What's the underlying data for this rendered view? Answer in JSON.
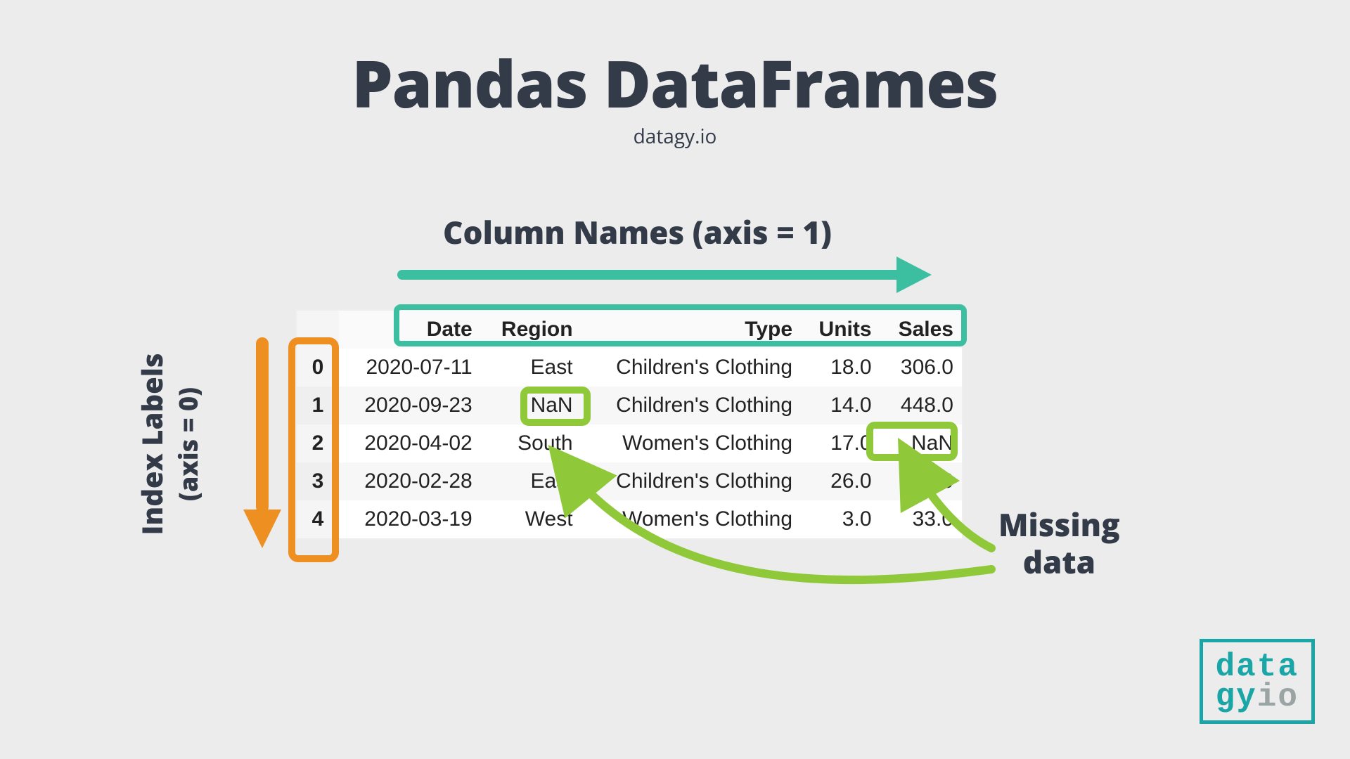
{
  "title": "Pandas DataFrames",
  "subtitle": "datagy.io",
  "labels": {
    "columns": "Column Names (axis = 1)",
    "index_line1": "Index Labels",
    "index_line2": "(axis = 0)",
    "missing_line1": "Missing",
    "missing_line2": "data"
  },
  "columns": [
    "Date",
    "Region",
    "Type",
    "Units",
    "Sales"
  ],
  "index": [
    "0",
    "1",
    "2",
    "3",
    "4"
  ],
  "rows": [
    {
      "Date": "2020-07-11",
      "Region": "East",
      "Type": "Children's Clothing",
      "Units": "18.0",
      "Sales": "306.0"
    },
    {
      "Date": "2020-09-23",
      "Region": "NaN",
      "Type": "Children's Clothing",
      "Units": "14.0",
      "Sales": "448.0"
    },
    {
      "Date": "2020-04-02",
      "Region": "South",
      "Type": "Women's Clothing",
      "Units": "17.0",
      "Sales": "NaN"
    },
    {
      "Date": "2020-02-28",
      "Region": "East",
      "Type": "Children's Clothing",
      "Units": "26.0",
      "Sales": "832.0"
    },
    {
      "Date": "2020-03-19",
      "Region": "West",
      "Type": "Women's Clothing",
      "Units": "3.0",
      "Sales": "33.0"
    }
  ],
  "logo": {
    "r1": "data",
    "r2a": "gy",
    "r2b": "io"
  },
  "annotations": {
    "column_header_highlight": true,
    "index_column_highlight": true,
    "missing_cells": [
      {
        "row": 1,
        "col": "Region"
      },
      {
        "row": 2,
        "col": "Sales"
      }
    ]
  }
}
